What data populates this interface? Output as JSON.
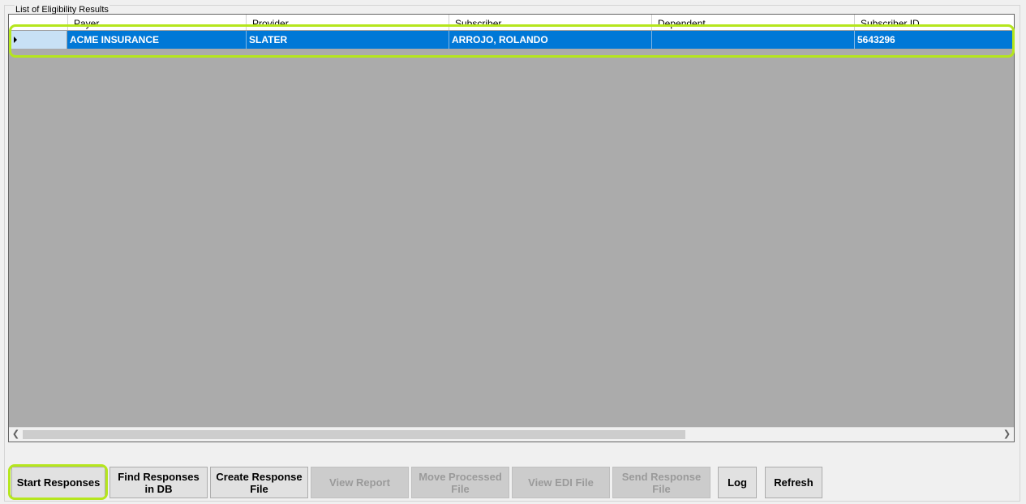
{
  "group": {
    "title": "List of Eligibility Results"
  },
  "grid": {
    "columns": [
      "Payer",
      "Provider",
      "Subscriber",
      "Dependent",
      "Subscriber ID"
    ],
    "rows": [
      {
        "payer": "ACME INSURANCE",
        "provider": "SLATER",
        "subscriber": "ARROJO, ROLANDO",
        "dependent": "",
        "subscriber_id": "5643296"
      }
    ],
    "scroll_left_icon": "scroll-left-icon",
    "scroll_right_icon": "scroll-right-icon"
  },
  "buttons": {
    "start_responses": "Start Responses",
    "find_responses_l1": "Find Responses",
    "find_responses_l2": "in DB",
    "create_response_l1": "Create Response",
    "create_response_l2": "File",
    "view_report": "View Report",
    "move_processed_l1": "Move Processed",
    "move_processed_l2": "File",
    "view_edi_file": "View EDI File",
    "send_response_l1": "Send Response",
    "send_response_l2": "File",
    "log": "Log",
    "refresh": "Refresh"
  },
  "colors": {
    "selection": "#0078d7",
    "grid_background": "#ababab",
    "highlight": "#b5e61d"
  }
}
